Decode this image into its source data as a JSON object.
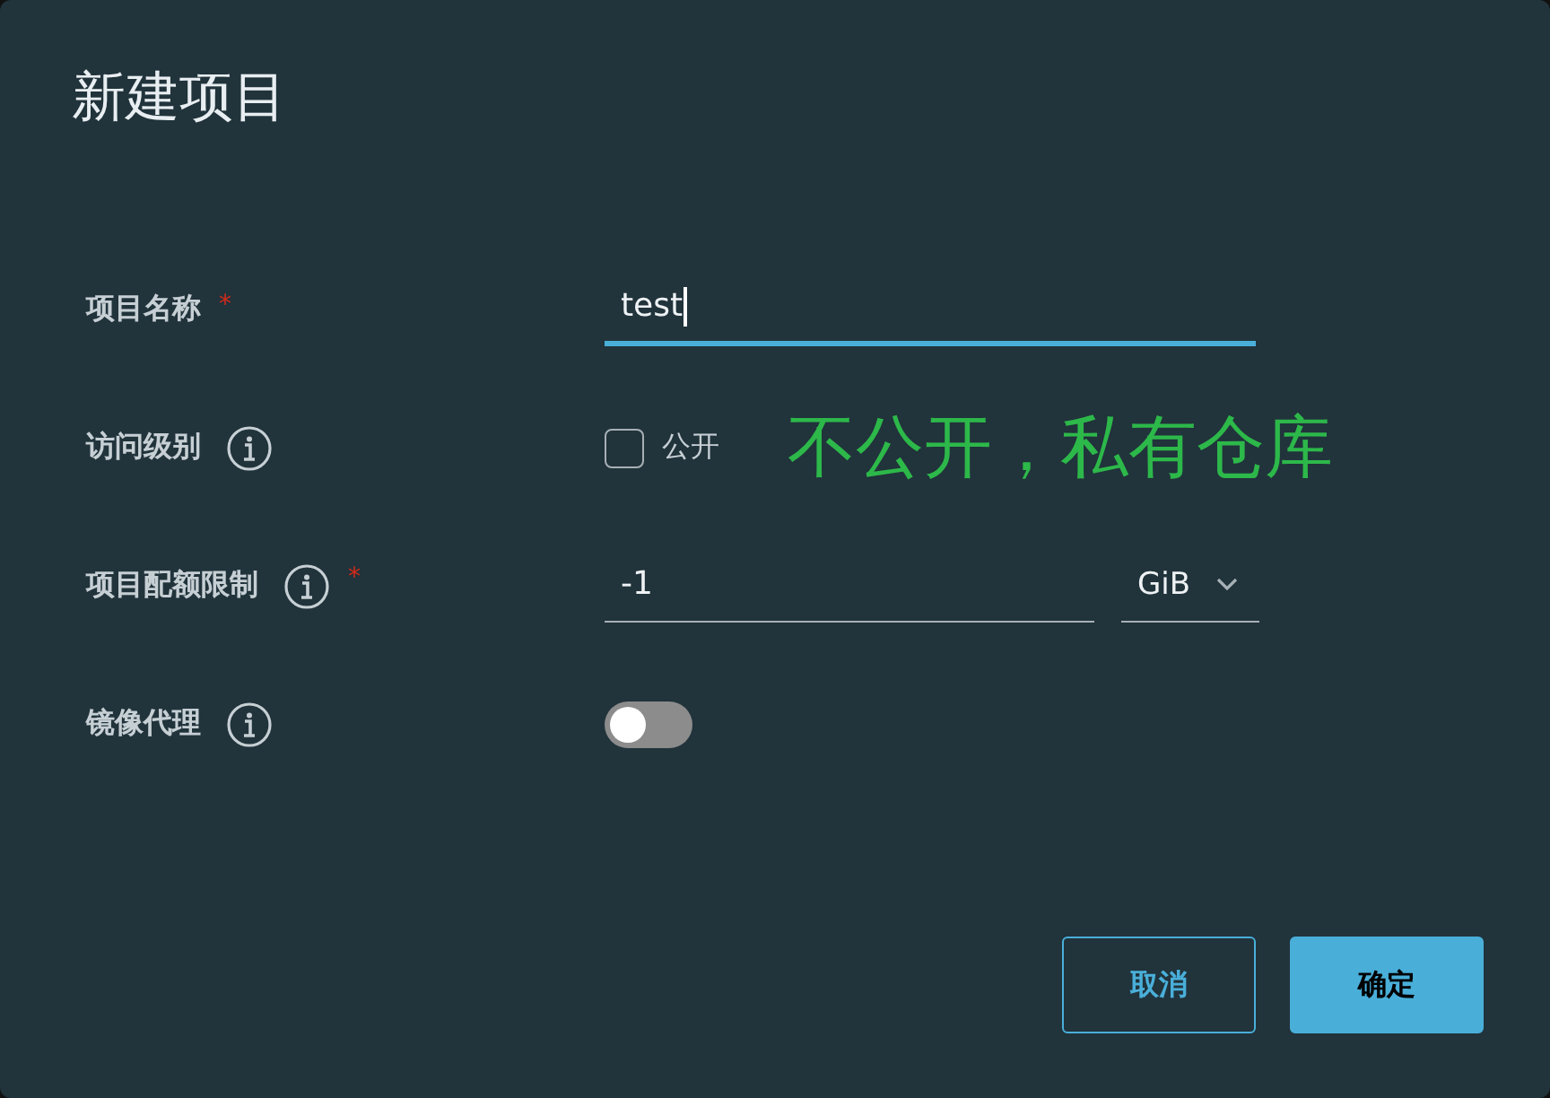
{
  "dialog": {
    "title": "新建项目"
  },
  "fields": [
    {
      "kind": "text",
      "label": "项目名称",
      "info": false,
      "required_mark": "*",
      "value": "test",
      "focused": true
    },
    {
      "kind": "checkbox",
      "label": "访问级别",
      "info": true,
      "checked": false,
      "option": "公开",
      "annotation": "不公开，私有仓库"
    },
    {
      "kind": "quota",
      "label": "项目配额限制",
      "info": true,
      "required_mark": "*",
      "value": "-1",
      "unit": "GiB",
      "focused": false
    },
    {
      "kind": "toggle",
      "label": "镜像代理",
      "info": true,
      "on": false
    }
  ],
  "buttons": [
    {
      "label": "取消",
      "primary": false
    },
    {
      "label": "确定",
      "primary": true
    }
  ]
}
